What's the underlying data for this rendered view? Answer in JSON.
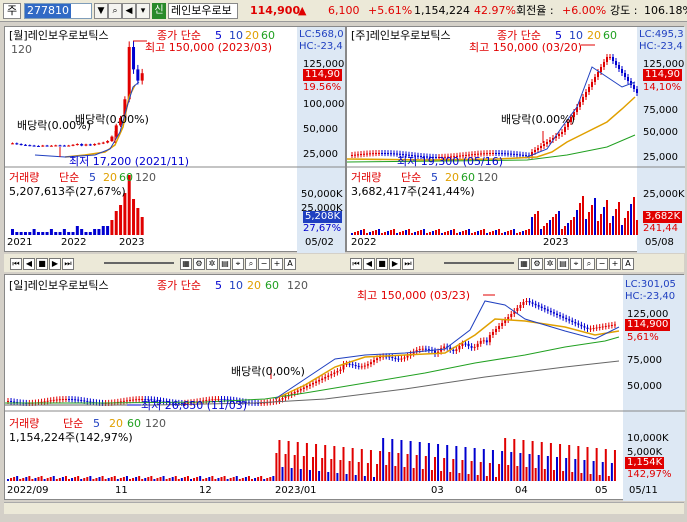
{
  "topbar": {
    "mode": "주",
    "code": "277810",
    "name": "레인보우로보",
    "price": "114,900",
    "change_arrow": "▲",
    "change": "6,100",
    "change_pct": "+5.61%",
    "volume": "1,154,224",
    "volume_pct": "42.97%",
    "turnover_label": "회전율 :",
    "turnover": "+6.00%",
    "strength_label": "강도 :",
    "strength": "106.18%",
    "sin_label": "신"
  },
  "monthly": {
    "title": "[월]레인보우로보틱스",
    "ma_label": "종가 단순",
    "ma": [
      "5",
      "10",
      "20",
      "60"
    ],
    "ma_extra": "120",
    "lc": "LC:568,0",
    "hc": "HC:-23,4",
    "price_badge": "114,90",
    "pct_badge": "19.56%",
    "ticks": [
      "125,000",
      "100,000",
      "75,000",
      "50,000",
      "25,000"
    ],
    "high": "최고 150,000 (2023/03)",
    "low": "최저 17,200 (2021/11)",
    "div1": "배당락(0.00%)",
    "div2": "배당락(0.00%)",
    "vol_title": "거래량",
    "vol_ma": "단순",
    "vol_ma_vals": [
      "5",
      "20",
      "60",
      "120"
    ],
    "vol_value": "5,207,613주(27,67%)",
    "vol_ticks": [
      "50,000K",
      "25,000K"
    ],
    "vol_badge": "5,208K",
    "vol_pct": "27,67%",
    "dates": [
      "2021",
      "2022",
      "2023"
    ],
    "end_date": "05/02",
    "chart_data": {
      "type": "candlestick",
      "closes": [
        21000,
        20000,
        19000,
        18500,
        18000,
        17500,
        17200,
        18000,
        17500,
        17800,
        18200,
        18000,
        17800,
        18000,
        19000,
        20000,
        18000,
        19500,
        18500,
        20000,
        21000,
        22000,
        24000,
        30000,
        45000,
        55000,
        80000,
        150000,
        120000,
        105000,
        114900
      ],
      "ylim": [
        0,
        150000
      ]
    }
  },
  "weekly": {
    "title": "[주]레인보우로보틱스",
    "ma_label": "종가 단순",
    "ma": [
      "5",
      "10",
      "20",
      "60"
    ],
    "lc": "LC:495,3",
    "hc": "HC:-23,4",
    "price_badge": "114,90",
    "pct_badge": "14,10%",
    "ticks": [
      "125,000",
      "100,000",
      "75,000",
      "50,000",
      "25,000"
    ],
    "high": "최고 150,000 (03/20)",
    "low": "최저 19,300 (05/16)",
    "div": "배당락(0.00%)",
    "vol_title": "거래량",
    "vol_ma": "단순",
    "vol_ma_vals": [
      "5",
      "20",
      "60",
      "120"
    ],
    "vol_value": "3,682,417주(241,44%)",
    "vol_ticks": [
      "25,000K"
    ],
    "vol_badge": "3,682K",
    "vol_pct": "241,44",
    "dates": [
      "2022",
      "2023"
    ],
    "end_date": "05/08"
  },
  "daily": {
    "title": "[일]레인보우로보틱스",
    "ma_label": "종가 단순",
    "ma": [
      "5",
      "10",
      "20",
      "60"
    ],
    "ma_extra": "120",
    "lc": "LC:301,05",
    "hc": "HC:-23,40",
    "price_badge": "114,900",
    "pct_badge": "5,61%",
    "ticks": [
      "125,000",
      "100,000",
      "75,000",
      "50,000"
    ],
    "high": "최고 150,000 (03/23)",
    "low": "최저 26,650 (11/03)",
    "div": "배당락(0,00%)",
    "vol_title": "거래량",
    "vol_ma": "단순",
    "vol_ma_vals": [
      "5",
      "20",
      "60",
      "120"
    ],
    "vol_value": "1,154,224주(142,97%)",
    "vol_ticks": [
      "10,000K",
      "5,000K"
    ],
    "vol_badge": "1,154K",
    "vol_pct": "142,97%",
    "dates": [
      "2022/09",
      "11",
      "12",
      "2023/01",
      "03",
      "04",
      "05"
    ],
    "end_date": "05/11"
  },
  "colors": {
    "up": "#e00000",
    "down": "#0000d0",
    "ma5": "#e00000",
    "ma10": "#2040c0",
    "ma20": "#e0a000",
    "ma60": "#20a020",
    "ma120": "#666666"
  }
}
